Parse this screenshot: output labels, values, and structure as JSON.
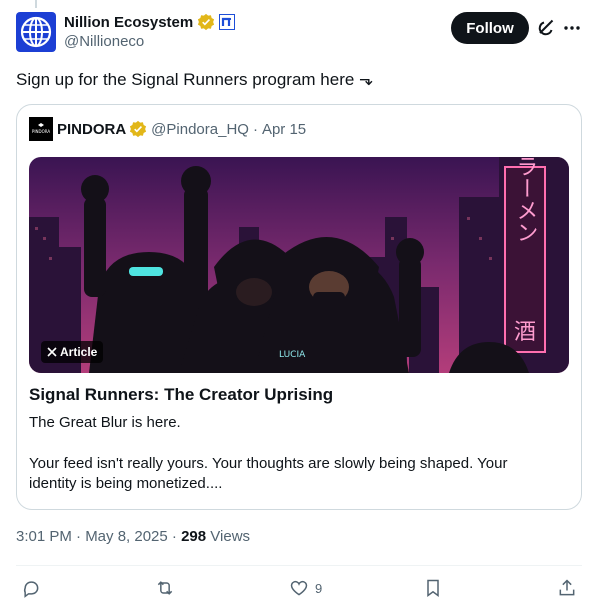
{
  "post": {
    "author_name": "Nillion Ecosystem",
    "author_handle": "@Nillioneco",
    "follow_label": "Follow",
    "text": "Sign up for the Signal Runners program here ⬎",
    "timestamp": "3:01 PM · May 8, 2025",
    "views_count": "298",
    "views_label": "Views"
  },
  "quote": {
    "author_name": "PINDORA",
    "author_handle": "@Pindora_HQ",
    "separator": "·",
    "date": "Apr 15",
    "avatar_text": "PINDORA",
    "badge_label": "Article",
    "article_title": "Signal Runners: The Creator Uprising",
    "article_subtitle": "The Great Blur is here.",
    "article_body": "Your feed isn't really yours. Your thoughts are slowly being shaped. Your identity is being monetized....",
    "image_texts": {
      "lucia_label": "LUCIA",
      "neon_sign": "ラーメン",
      "neon_sign_2": "酒"
    }
  },
  "actions": {
    "reply_count": "",
    "retweet_count": "",
    "like_count": "9",
    "bookmark_count": ""
  },
  "icons": {
    "verified": "gold-verified-badge",
    "affiliation": "affiliate-badge",
    "grok": "grok-icon",
    "more": "more-icon"
  },
  "colors": {
    "verified_gold": "#e2b719",
    "affiliate_blue": "#1d4ed8",
    "secondary_text": "#536471",
    "border": "#cfd9de"
  }
}
